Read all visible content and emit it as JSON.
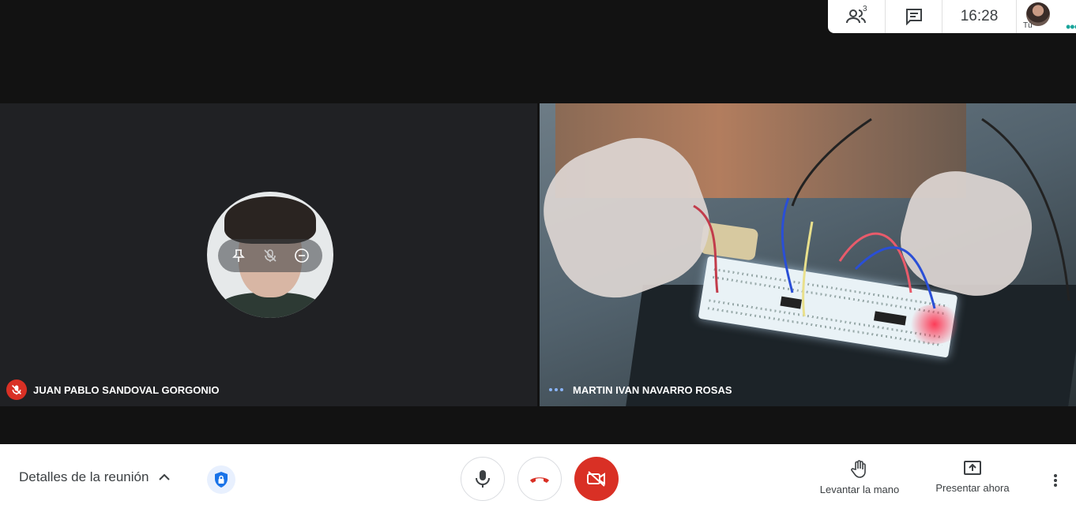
{
  "topbar": {
    "participant_count": "3",
    "time": "16:28",
    "self_label": "Tú",
    "icons": [
      "people-icon",
      "chat-icon"
    ]
  },
  "tiles": [
    {
      "name": "JUAN PABLO SANDOVAL GORGONIO",
      "muted": true
    },
    {
      "name": "MARTIN IVAN NAVARRO ROSAS",
      "speaking": true
    }
  ],
  "bottombar": {
    "details_label": "Detalles de la reunión",
    "raise_hand_label": "Levantar la mano",
    "present_label": "Presentar ahora"
  },
  "colors": {
    "danger": "#d93025",
    "accent": "#1a73e8",
    "speaking": "#8ab4f8"
  }
}
